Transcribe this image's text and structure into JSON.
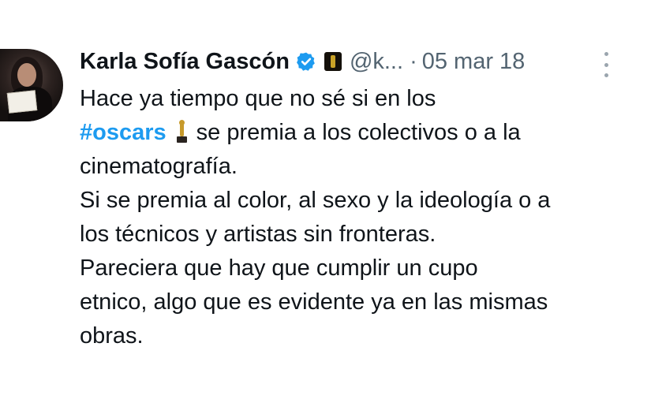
{
  "tweet": {
    "author": {
      "display_name": "Karla Sofía Gascón",
      "handle": "@k...",
      "separator": "·",
      "date": "05 mar 18",
      "verified_icon": "verified-badge-icon",
      "affiliation_icon": "oscar-badge-icon"
    },
    "text": {
      "line1": "Hace ya tiempo que no sé si en los",
      "hashtag": "#oscars",
      "line2_rest": "se premia a los colectivos o a la",
      "line3": "cinematografía.",
      "line4": "Si se premia al color, al sexo y la ideología o a",
      "line5": "los técnicos y artistas sin fronteras.",
      "line6": "Pareciera que hay que cumplir un cupo",
      "line7": "etnico, algo que es evidente ya en las mismas",
      "line8": "obras."
    },
    "menu_icon": "more-options-icon"
  },
  "colors": {
    "link": "#1d9bf0",
    "text": "#0f1419",
    "muted": "#536471",
    "verified": "#1d9bf0"
  }
}
